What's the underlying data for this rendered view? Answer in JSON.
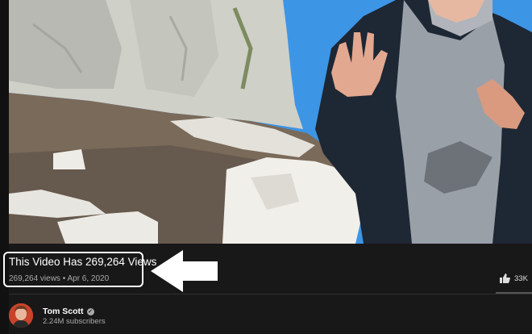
{
  "video": {
    "title": "This Video Has 269,264 Views",
    "views": "269,264 views",
    "separator": "•",
    "date": "Apr 6, 2020"
  },
  "actions": {
    "like_icon": "thumbs-up-icon",
    "like_count": "33K"
  },
  "channel": {
    "name": "Tom Scott",
    "verified_icon": "verified-check-icon",
    "subscribers": "2.24M subscribers"
  },
  "colors": {
    "background": "#181818",
    "highlight_border": "#ffffff",
    "secondary_text": "#aaaaaa"
  }
}
